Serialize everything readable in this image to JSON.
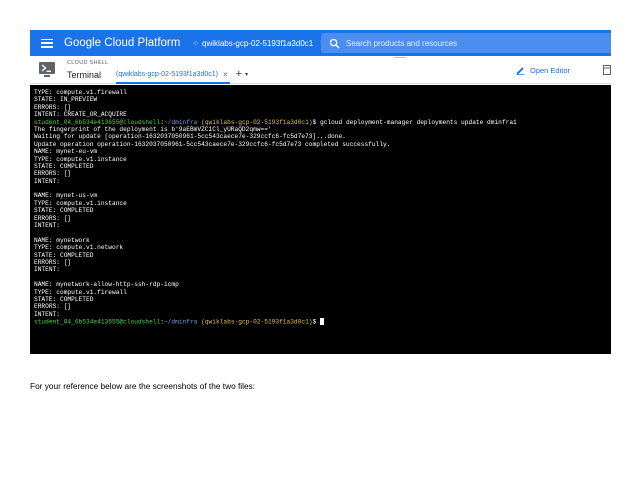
{
  "header": {
    "brand": "Google Cloud Platform",
    "project": "qwiklabs-gcp-02-5193f1a3d0c1",
    "search_placeholder": "Search products and resources",
    "colors": {
      "bar": "#1a73e8",
      "search": "#4c8ef0"
    }
  },
  "shell": {
    "subtitle": "CLOUD SHELL",
    "title": "Terminal",
    "tab_label": "(qwiklabs-gcp-02-5193f1a3d0c1)",
    "tab_close": "×",
    "add_tab": "+",
    "add_tab_caret": "▾",
    "open_editor": "Open Editor",
    "icons": [
      "terminal-icon",
      "close-icon",
      "plus-icon",
      "pencil-icon"
    ]
  },
  "terminal": {
    "prompt": {
      "user": "student_04_6b534e413655@cloudshell",
      "colon": ":",
      "path": "~/dminfra",
      "project": "(qwiklabs-gcp-02-5193f1a3d0c1)",
      "dollar": "$ "
    },
    "command": "gcloud deployment-manager deployments update dminfra1",
    "before": [
      "TYPE: compute.v1.firewall",
      "STATE: IN_PREVIEW",
      "ERRORS: []",
      "INTENT: CREATE_OR_ACQUIRE"
    ],
    "after": [
      "The fingerprint of the deployment is b'9aEBmVZC1Cl_yURaQD2qmw=='",
      "Waiting for update [operation-1632037050961-5cc543caece7e-329ccfc6-fc5d7e73]...done.",
      "Update operation operation-1632037050961-5cc543caece7e-329ccfc6-fc5d7e73 completed successfully.",
      "NAME: mynet-eu-vm",
      "TYPE: compute.v1.instance",
      "STATE: COMPLETED",
      "ERRORS: []",
      "INTENT:",
      "",
      "NAME: mynet-us-vm",
      "TYPE: compute.v1.instance",
      "STATE: COMPLETED",
      "ERRORS: []",
      "INTENT:",
      "",
      "NAME: mynetwork",
      "TYPE: compute.v1.network",
      "STATE: COMPLETED",
      "ERRORS: []",
      "INTENT:",
      "",
      "NAME: mynetwork-allow-http-ssh-rdp-icmp",
      "TYPE: compute.v1.firewall",
      "STATE: COMPLETED",
      "ERRORS: []",
      "INTENT:"
    ],
    "colors": {
      "user": "#4ad94a",
      "path": "#6f9be8",
      "project": "#e3c04a"
    }
  },
  "caption": "For your reference below are the screenshots of the two files:"
}
